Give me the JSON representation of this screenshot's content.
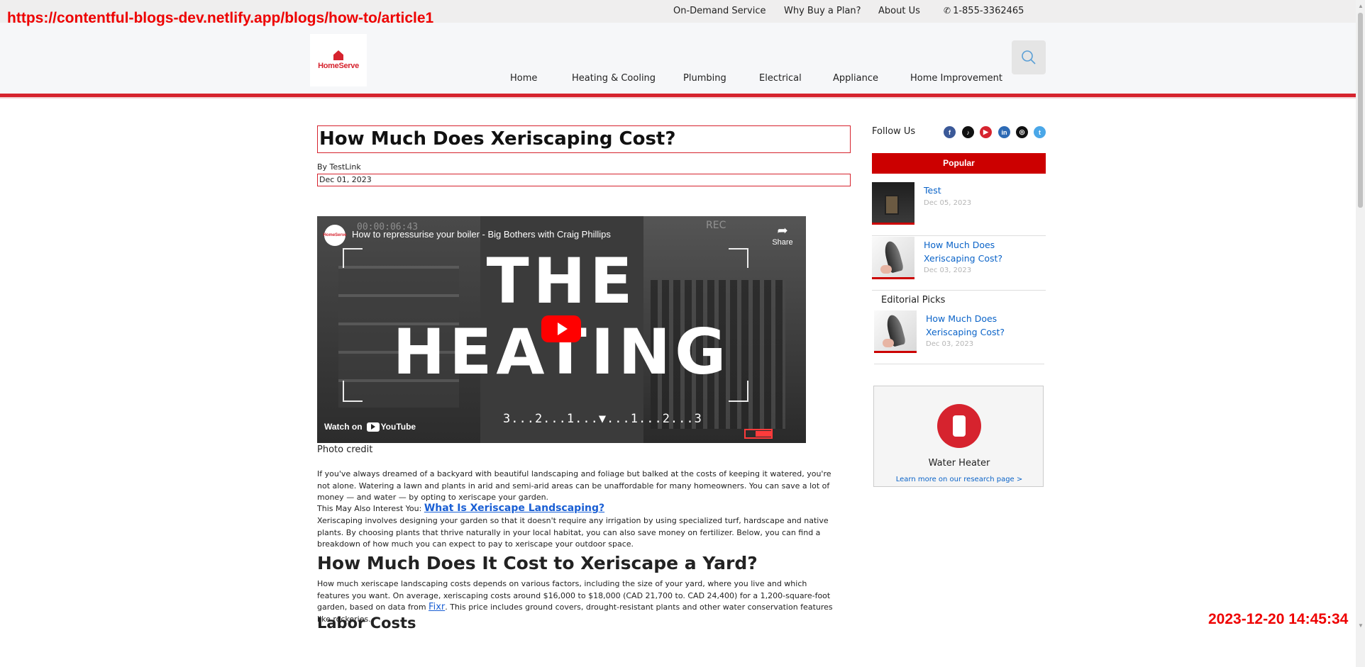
{
  "overlay": {
    "url": "https://contentful-blogs-dev.netlify.app/blogs/how-to/article1",
    "timestamp": "2023-12-20 14:45:34"
  },
  "utility_nav": {
    "items": [
      "On-Demand Service",
      "Why Buy a Plan?",
      "About Us"
    ],
    "phone": "1-855-3362465"
  },
  "brand": {
    "logo_text": "HomeServe",
    "accent": "#d6232e"
  },
  "main_nav": [
    "Home",
    "Heating & Cooling",
    "Plumbing",
    "Electrical",
    "Appliance",
    "Home Improvement"
  ],
  "article": {
    "title": "How Much Does Xeriscaping Cost?",
    "byline": "By TestLink",
    "date": "Dec 01, 2023",
    "video": {
      "channel_logo": "HomeServe",
      "title": "How to repressurise your boiler - Big Bothers with Craig Phillips",
      "timecode": "00:00:06:43",
      "rec_label": "REC",
      "share_label": "Share",
      "headline_line1": "THE",
      "headline_line2": "HEATING",
      "countdown": "3...2...1...▼...1...2...3",
      "watch_on": "Watch on",
      "youtube": "YouTube"
    },
    "photo_credit": "Photo credit",
    "paragraph1": "If you've always dreamed of a backyard with beautiful landscaping and foliage but balked at the costs of keeping it watered, you're not alone. Watering a lawn and plants in arid and semi-arid areas can be unaffordable for many homeowners. You can save a lot of money — and water — by opting to xeriscape your garden.",
    "interest_label": "This May Also Interest You:",
    "interest_link": "What Is Xeriscape Landscaping?",
    "paragraph2": "Xeriscaping involves designing your garden so that it doesn't require any irrigation by using specialized turf, hardscape and native plants. By choosing plants that thrive naturally in your local habitat, you can also save money on fertilizer. Below, you can find a breakdown of how much you can expect to pay to xeriscape your outdoor space.",
    "heading2": "How Much Does It Cost to Xeriscape a Yard?",
    "paragraph3_a": "How much xeriscape landscaping costs depends on various factors, including the size of your yard, where you live and which features you want. On average, xeriscaping costs around $16,000 to $18,000 (CAD 21,700 to. CAD 24,400) for a 1,200-square-foot garden, based on data from",
    "paragraph3_link": "Fixr",
    "paragraph3_b": ". This price includes ground covers, drought-resistant plants and other water conservation features like rockeries.",
    "heading3": "Labor Costs"
  },
  "sidebar": {
    "follow_label": "Follow Us",
    "social": [
      {
        "icon": "facebook-icon",
        "glyph": "f",
        "color": "#3b5998"
      },
      {
        "icon": "tiktok-icon",
        "glyph": "♪",
        "color": "#111111"
      },
      {
        "icon": "youtube-icon",
        "glyph": "▶",
        "color": "#d6232e"
      },
      {
        "icon": "linkedin-icon",
        "glyph": "in",
        "color": "#2d6ab5"
      },
      {
        "icon": "instagram-icon",
        "glyph": "◎",
        "color": "#111111"
      },
      {
        "icon": "twitter-icon",
        "glyph": "t",
        "color": "#4aa7e8"
      }
    ],
    "popular_label": "Popular",
    "popular": [
      {
        "title": "Test",
        "date": "Dec 05, 2023"
      },
      {
        "title": "How Much Does Xeriscaping Cost?",
        "date": "Dec 03, 2023"
      }
    ],
    "editorial_label": "Editorial Picks",
    "editorial": [
      {
        "title": "How Much Does Xeriscaping Cost?",
        "date": "Dec 03, 2023"
      }
    ],
    "promo": {
      "title": "Water Heater",
      "link": "Learn more on our research page >"
    }
  }
}
